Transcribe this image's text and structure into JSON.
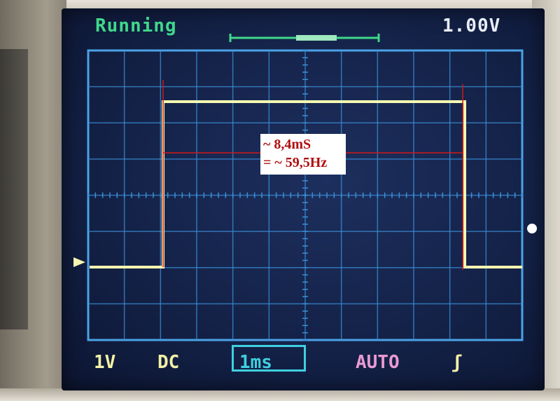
{
  "screen": {
    "status": "Running",
    "voltage_readout": "1.00V"
  },
  "bottom_bar": {
    "channel_scale": "1V",
    "coupling": "DC",
    "timebase": "1ms",
    "trigger_mode": "AUTO",
    "trigger_edge": "ʃ"
  },
  "annotation": {
    "line1": "~ 8,4mS",
    "line2": "= ~ 59,5Hz"
  },
  "colors": {
    "trace": "#f4f7b0",
    "grid": "#3a8fd8",
    "annotation_line": "#d01818",
    "screen_bg": "#142248",
    "status_text": "#3fd88a",
    "timebase_accent": "#3fd0e0",
    "trigger_mode": "#ea9ad2"
  }
}
